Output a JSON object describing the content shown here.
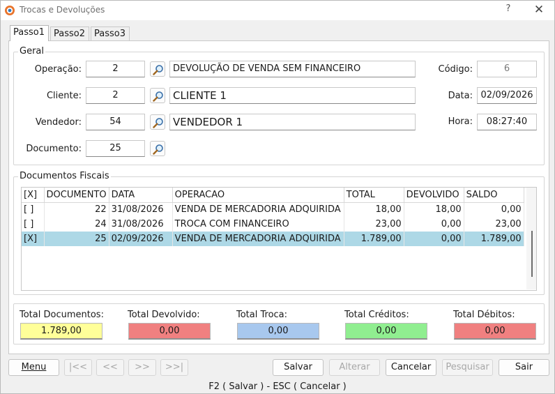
{
  "window": {
    "title": "Trocas e Devoluções",
    "help_glyph": "?",
    "close_glyph": "✕"
  },
  "tabs": [
    {
      "label": "Passo1",
      "active": true
    },
    {
      "label": "Passo2",
      "active": false
    },
    {
      "label": "Passo3",
      "active": false
    }
  ],
  "geral": {
    "title": "Geral",
    "operacao_label": "Operação:",
    "operacao_code": "2",
    "operacao_desc": "DEVOLUÇÃO DE VENDA SEM FINANCEIRO",
    "cliente_label": "Cliente:",
    "cliente_code": "2",
    "cliente_name": "CLIENTE 1",
    "vendedor_label": "Vendedor:",
    "vendedor_code": "54",
    "vendedor_name": "VENDEDOR 1",
    "documento_label": "Documento:",
    "documento_value": "25",
    "codigo_label": "Código:",
    "codigo_value": "6",
    "data_label": "Data:",
    "data_value": "02/09/2026",
    "hora_label": "Hora:",
    "hora_value": "08:27:40"
  },
  "docs": {
    "title": "Documentos Fiscais",
    "columns": [
      "[X]",
      "DOCUMENTO",
      "DATA",
      "OPERACAO",
      "TOTAL",
      "DEVOLVIDO",
      "SALDO"
    ],
    "rows": [
      {
        "check": "[ ]",
        "documento": "22",
        "data": "31/08/2026",
        "operacao": "VENDA DE MERCADORIA ADQUIRIDA",
        "total": "18,00",
        "devolvido": "18,00",
        "saldo": "0,00"
      },
      {
        "check": "[ ]",
        "documento": "24",
        "data": "31/08/2026",
        "operacao": "TROCA COM FINANCEIRO",
        "total": "23,00",
        "devolvido": "0,00",
        "saldo": "23,00"
      },
      {
        "check": "[X]",
        "documento": "25",
        "data": "02/09/2026",
        "operacao": "VENDA DE MERCADORIA ADQUIRIDA",
        "total": "1.789,00",
        "devolvido": "0,00",
        "saldo": "1.789,00"
      }
    ]
  },
  "totals": [
    {
      "label": "Total Documentos:",
      "value": "1.789,00",
      "color": "#ffff99"
    },
    {
      "label": "Total Devolvido:",
      "value": "0,00",
      "color": "#f08080"
    },
    {
      "label": "Total Troca:",
      "value": "0,00",
      "color": "#a8c8ee"
    },
    {
      "label": "Total Créditos:",
      "value": "0,00",
      "color": "#90ee90"
    },
    {
      "label": "Total Débitos:",
      "value": "0,00",
      "color": "#f08080"
    }
  ],
  "buttons": {
    "menu": "Menu",
    "first": "|<<",
    "prev": "<<",
    "next": ">>",
    "last": ">>|",
    "salvar": "Salvar",
    "alterar": "Alterar",
    "cancelar": "Cancelar",
    "pesquisar": "Pesquisar",
    "sair": "Sair"
  },
  "status": {
    "text": "F2 ( Salvar )  -  ESC ( Cancelar )"
  },
  "icons": {
    "app": "app-logo-icon",
    "lookup": "magnifier-icon"
  }
}
